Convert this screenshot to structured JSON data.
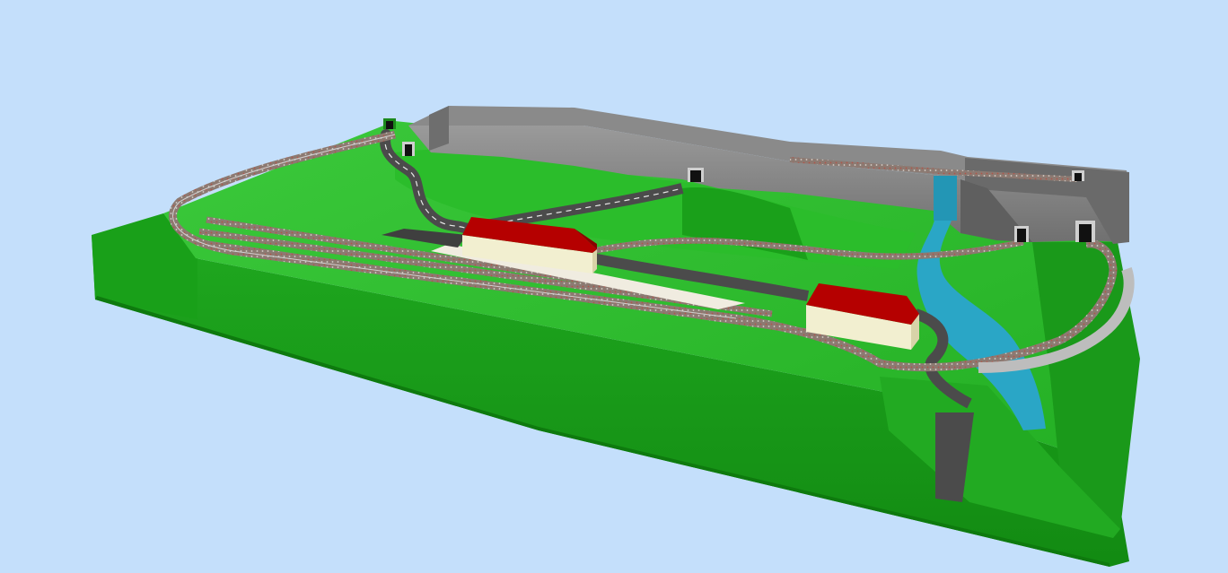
{
  "scene": {
    "type": "3d-model-railway-layout-render",
    "colors": {
      "sky": "#c4dffb",
      "grass_light": "#35c235",
      "grass": "#1ea61e",
      "grass_dark": "#128a12",
      "rock_light": "#9a9a9a",
      "rock": "#7d7d7d",
      "rock_dark": "#5f5f5f",
      "water": "#2aa6c6",
      "road": "#4b4b4b",
      "road_line": "#e8e8e8",
      "track_ballast": "#8c7a72",
      "rail": "#c8c8c8",
      "roof": "#b50000",
      "wall": "#f2efd0",
      "platform": "#f0ece0"
    },
    "objects": [
      {
        "kind": "baseboard",
        "icon": "terrain-block"
      },
      {
        "kind": "rock-cliff",
        "icon": "mountain-icon"
      },
      {
        "kind": "river",
        "icon": "river-icon"
      },
      {
        "kind": "road",
        "icon": "road-icon"
      },
      {
        "kind": "station-building",
        "icon": "building-icon"
      },
      {
        "kind": "goods-shed",
        "icon": "building-icon"
      },
      {
        "kind": "tunnel-portal",
        "count": 6,
        "icon": "tunnel-icon"
      },
      {
        "kind": "track",
        "icon": "rail-track-icon"
      },
      {
        "kind": "bridge",
        "icon": "bridge-icon"
      }
    ]
  }
}
